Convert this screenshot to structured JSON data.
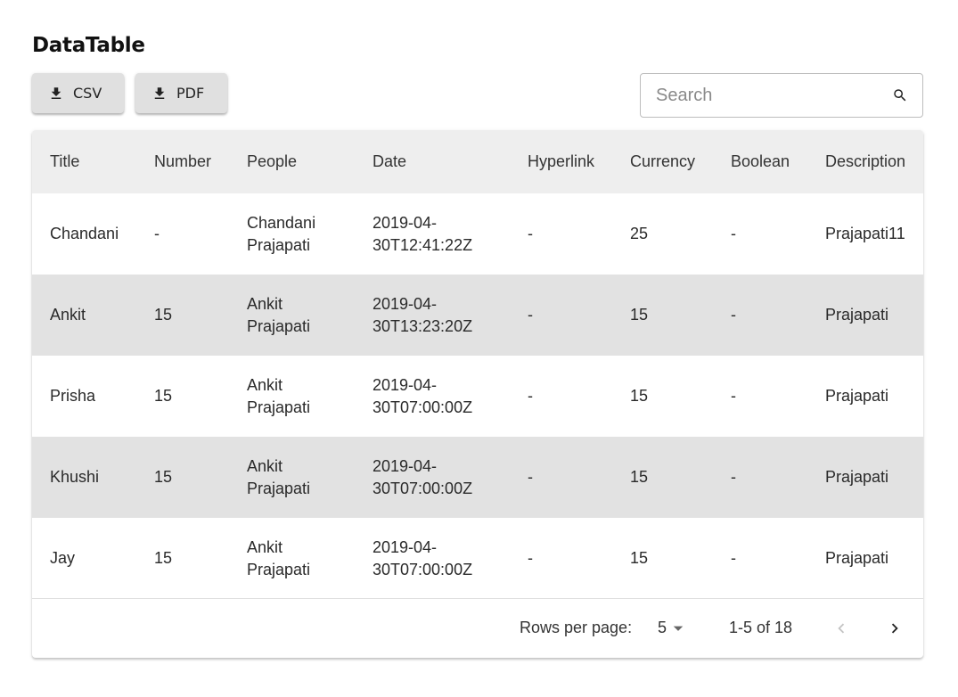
{
  "page": {
    "title": "DataTable"
  },
  "toolbar": {
    "csv_label": "CSV",
    "pdf_label": "PDF",
    "download_icon": "download-icon"
  },
  "search": {
    "placeholder": "Search",
    "value": "",
    "icon": "search-icon"
  },
  "table": {
    "columns": [
      "Title",
      "Number",
      "People",
      "Date",
      "Hyperlink",
      "Currency",
      "Boolean",
      "Description"
    ],
    "rows": [
      {
        "title": "Chandani",
        "number": "-",
        "people_first": "Chandani",
        "people_last": "Prajapati",
        "date_a": "2019-04-",
        "date_b": "30T12:41:22Z",
        "hyperlink": "-",
        "currency": "25",
        "boolean": "-",
        "description": "Prajapati11"
      },
      {
        "title": "Ankit",
        "number": "15",
        "people_first": "Ankit",
        "people_last": "Prajapati",
        "date_a": "2019-04-",
        "date_b": "30T13:23:20Z",
        "hyperlink": "-",
        "currency": "15",
        "boolean": "-",
        "description": "Prajapati"
      },
      {
        "title": "Prisha",
        "number": "15",
        "people_first": "Ankit",
        "people_last": "Prajapati",
        "date_a": "2019-04-",
        "date_b": "30T07:00:00Z",
        "hyperlink": "-",
        "currency": "15",
        "boolean": "-",
        "description": "Prajapati"
      },
      {
        "title": "Khushi",
        "number": "15",
        "people_first": "Ankit",
        "people_last": "Prajapati",
        "date_a": "2019-04-",
        "date_b": "30T07:00:00Z",
        "hyperlink": "-",
        "currency": "15",
        "boolean": "-",
        "description": "Prajapati"
      },
      {
        "title": "Jay",
        "number": "15",
        "people_first": "Ankit",
        "people_last": "Prajapati",
        "date_a": "2019-04-",
        "date_b": "30T07:00:00Z",
        "hyperlink": "-",
        "currency": "15",
        "boolean": "-",
        "description": "Prajapati"
      }
    ]
  },
  "pagination": {
    "rows_per_page_label": "Rows per page:",
    "rows_per_page_value": "5",
    "range_label": "1-5 of 18",
    "prev_icon": "chevron-left-icon",
    "next_icon": "chevron-right-icon"
  },
  "colors": {
    "header_bg": "#eeeeee",
    "alt_row_bg": "#e2e2e2",
    "button_bg": "#e0e0e0"
  }
}
